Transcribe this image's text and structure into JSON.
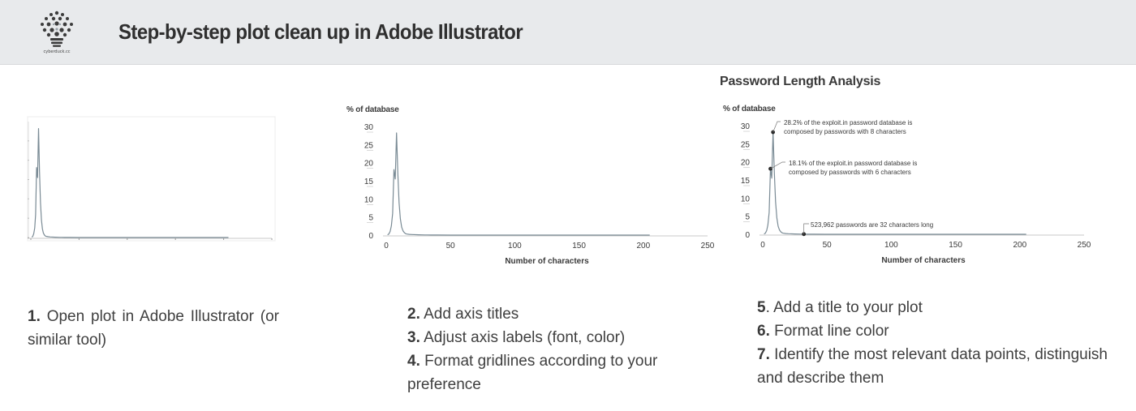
{
  "header": {
    "title": "Step-by-step plot clean up in Adobe Illustrator",
    "logo_text": "cyberduck.cc"
  },
  "panels": [
    {
      "ylabel": "",
      "xlabel": "",
      "title": ""
    },
    {
      "ylabel": "% of database",
      "xlabel": "Number of characters",
      "title": ""
    },
    {
      "ylabel": "% of database",
      "xlabel": "Number of characters",
      "title": "Password Length Analysis"
    }
  ],
  "annotations": [
    {
      "lines": [
        "28.2% of the exploit.in password database is",
        "composed by passwords with 8 characters"
      ]
    },
    {
      "lines": [
        "18.1% of the exploit.in password database is",
        "composed by passwords with 6 characters"
      ]
    },
    {
      "lines": [
        "523,962 passwords are 32 characters long"
      ]
    }
  ],
  "steps": {
    "s1": {
      "num": "1.",
      "text": " Open plot in Adobe Illustrator (or similar tool)"
    },
    "s2": {
      "num": "2.",
      "text": " Add axis titles"
    },
    "s3": {
      "num": "3.",
      "text": " Adjust axis labels (font, color)"
    },
    "s4": {
      "num": "4.",
      "text": " Format gridlines according to your preference"
    },
    "s5": {
      "num": "5",
      "text": ". Add a title to your plot"
    },
    "s6": {
      "num": "6.",
      "text": " Format line color"
    },
    "s7": {
      "num": "7.",
      "text": " Identify the most relevant data points, distinguish and describe them"
    }
  },
  "colors": {
    "line": "#7a8b95",
    "axis": "#c8c8c8",
    "dot": "#2a2a2a"
  },
  "chart_data": [
    {
      "type": "line",
      "title": "",
      "xlabel": "",
      "ylabel": "",
      "xlim": [
        0,
        250
      ],
      "ylim": [
        0,
        30
      ],
      "xticks": [],
      "yticks": [],
      "series": [
        {
          "x": [
            1,
            2,
            3,
            4,
            5,
            6,
            7,
            8,
            9,
            10,
            11,
            12,
            13,
            14,
            15,
            16,
            18,
            20,
            25,
            30,
            32,
            35,
            40,
            50,
            100,
            150,
            200,
            205
          ],
          "y": [
            0.1,
            0.3,
            1.0,
            2.5,
            6.0,
            18.1,
            15.5,
            28.2,
            17.0,
            9.0,
            4.5,
            2.2,
            1.2,
            0.7,
            0.4,
            0.3,
            0.2,
            0.15,
            0.08,
            0.05,
            0.04,
            0.03,
            0.02,
            0.01,
            0.005,
            0.003,
            0.002,
            0
          ]
        }
      ]
    },
    {
      "type": "line",
      "title": "",
      "xlabel": "Number of characters",
      "ylabel": "% of database",
      "xlim": [
        0,
        250
      ],
      "ylim": [
        0,
        30
      ],
      "xticks": [
        0,
        50,
        100,
        150,
        200,
        250
      ],
      "yticks": [
        0,
        5,
        10,
        15,
        20,
        25,
        30
      ],
      "series": [
        {
          "x": [
            1,
            2,
            3,
            4,
            5,
            6,
            7,
            8,
            9,
            10,
            11,
            12,
            13,
            14,
            15,
            16,
            18,
            20,
            25,
            30,
            32,
            35,
            40,
            50,
            100,
            150,
            200,
            205
          ],
          "y": [
            0.1,
            0.3,
            1.0,
            2.5,
            6.0,
            18.1,
            15.5,
            28.2,
            17.0,
            9.0,
            4.5,
            2.2,
            1.2,
            0.7,
            0.4,
            0.3,
            0.2,
            0.15,
            0.08,
            0.05,
            0.04,
            0.03,
            0.02,
            0.01,
            0.005,
            0.003,
            0.002,
            0
          ]
        }
      ]
    },
    {
      "type": "line",
      "title": "Password Length Analysis",
      "xlabel": "Number of characters",
      "ylabel": "% of database",
      "xlim": [
        0,
        250
      ],
      "ylim": [
        0,
        30
      ],
      "xticks": [
        0,
        50,
        100,
        150,
        200,
        250
      ],
      "yticks": [
        0,
        5,
        10,
        15,
        20,
        25,
        30
      ],
      "highlights": [
        {
          "x": 8,
          "y": 28.2
        },
        {
          "x": 6,
          "y": 18.1
        },
        {
          "x": 32,
          "y": 0.04
        }
      ],
      "series": [
        {
          "x": [
            1,
            2,
            3,
            4,
            5,
            6,
            7,
            8,
            9,
            10,
            11,
            12,
            13,
            14,
            15,
            16,
            18,
            20,
            25,
            30,
            32,
            35,
            40,
            50,
            100,
            150,
            200,
            205
          ],
          "y": [
            0.1,
            0.3,
            1.0,
            2.5,
            6.0,
            18.1,
            15.5,
            28.2,
            17.0,
            9.0,
            4.5,
            2.2,
            1.2,
            0.7,
            0.4,
            0.3,
            0.2,
            0.15,
            0.08,
            0.05,
            0.04,
            0.03,
            0.02,
            0.01,
            0.005,
            0.003,
            0.002,
            0
          ]
        }
      ]
    }
  ]
}
